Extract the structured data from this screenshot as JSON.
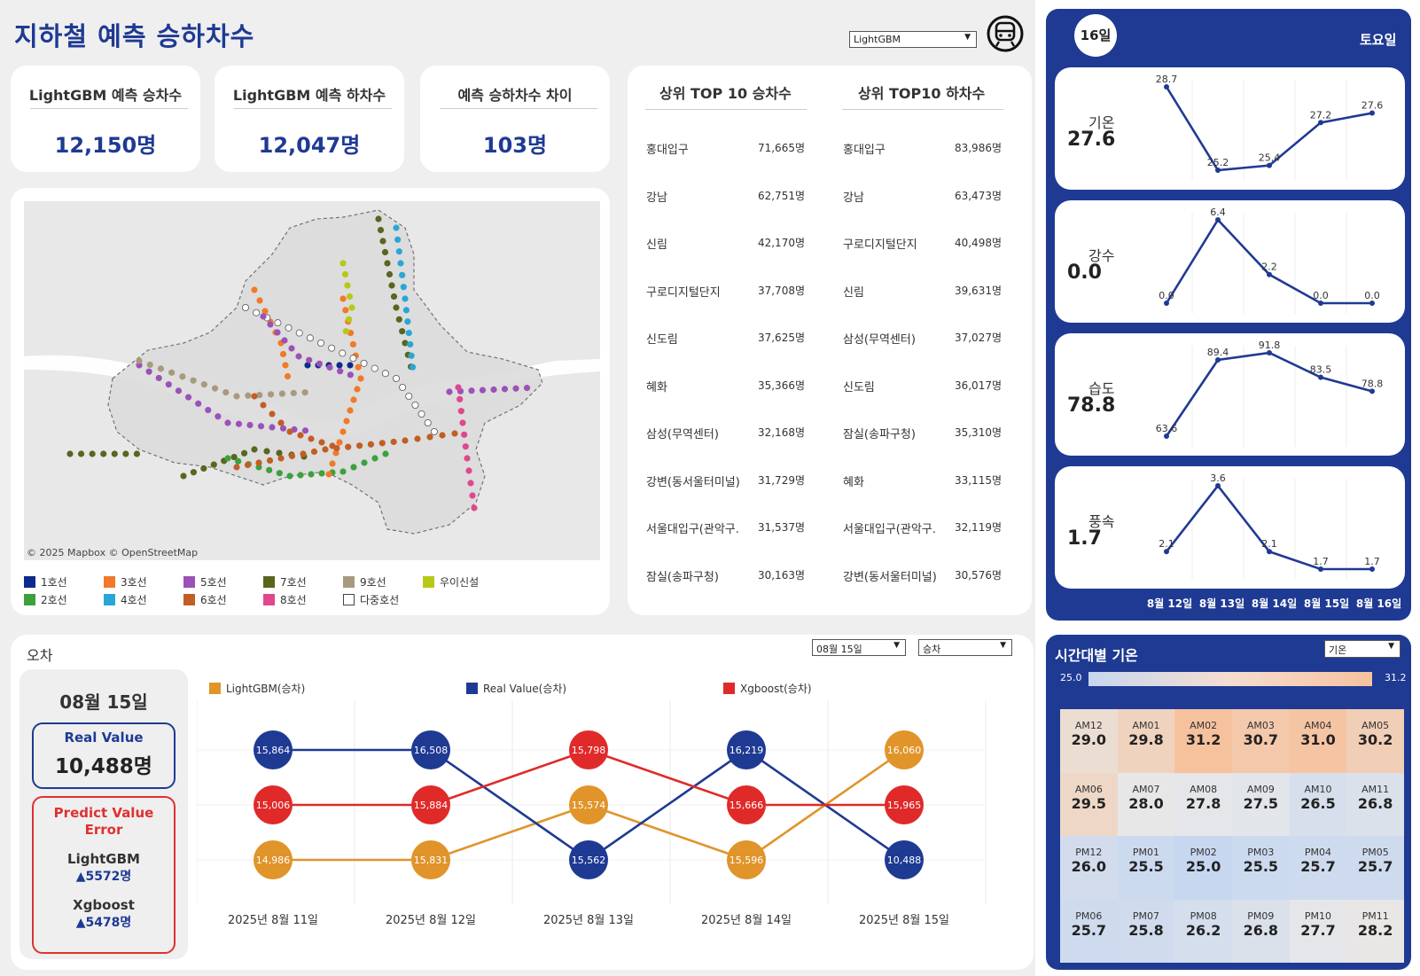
{
  "header": {
    "title": "지하철 예측 승하차수",
    "model_select": "LightGBM"
  },
  "kpis": [
    {
      "label": "LightGBM 예측 승차수",
      "value": "12,150명"
    },
    {
      "label": "LightGBM 예측 하차수",
      "value": "12,047명"
    },
    {
      "label": "예측 승하차수 차이",
      "value": "103명"
    }
  ],
  "map": {
    "credit": "© 2025 Mapbox  © OpenStreetMap",
    "legend": [
      {
        "label": "1호선",
        "color": "#0d2b8a"
      },
      {
        "label": "3호선",
        "color": "#f07a28"
      },
      {
        "label": "5호선",
        "color": "#9b52b8"
      },
      {
        "label": "7호선",
        "color": "#58661e"
      },
      {
        "label": "9호선",
        "color": "#a89a7e"
      },
      {
        "label": "우이신설",
        "color": "#b7c817"
      },
      {
        "label": "2호선",
        "color": "#3ca13c"
      },
      {
        "label": "4호선",
        "color": "#2aa6d6"
      },
      {
        "label": "6호선",
        "color": "#c25e24"
      },
      {
        "label": "8호선",
        "color": "#e0478e"
      },
      {
        "label": "다중호선",
        "color": "#ffffff"
      }
    ]
  },
  "top10": {
    "boarding_title": "상위 TOP 10 승차수",
    "alighting_title": "상위 TOP10 하차수",
    "boarding": [
      {
        "name": "홍대입구",
        "value": "71,665명"
      },
      {
        "name": "강남",
        "value": "62,751명"
      },
      {
        "name": "신림",
        "value": "42,170명"
      },
      {
        "name": "구로디지털단지",
        "value": "37,708명"
      },
      {
        "name": "신도림",
        "value": "37,625명"
      },
      {
        "name": "혜화",
        "value": "35,366명"
      },
      {
        "name": "삼성(무역센터)",
        "value": "32,168명"
      },
      {
        "name": "강변(동서울터미널)",
        "value": "31,729명"
      },
      {
        "name": "서울대입구(관악구.",
        "value": "31,537명"
      },
      {
        "name": "잠실(송파구청)",
        "value": "30,163명"
      }
    ],
    "alighting": [
      {
        "name": "홍대입구",
        "value": "83,986명"
      },
      {
        "name": "강남",
        "value": "63,473명"
      },
      {
        "name": "구로디지털단지",
        "value": "40,498명"
      },
      {
        "name": "신림",
        "value": "39,631명"
      },
      {
        "name": "삼성(무역센터)",
        "value": "37,027명"
      },
      {
        "name": "신도림",
        "value": "36,017명"
      },
      {
        "name": "잠실(송파구청)",
        "value": "35,310명"
      },
      {
        "name": "혜화",
        "value": "33,115명"
      },
      {
        "name": "서울대입구(관악구.",
        "value": "32,119명"
      },
      {
        "name": "강변(동서울터미널)",
        "value": "30,576명"
      }
    ]
  },
  "weather": {
    "day_badge": "16일",
    "weekday": "토요일",
    "dates": [
      "8월 12일",
      "8월 13일",
      "8월 14일",
      "8월 15일",
      "8월 16일"
    ],
    "metrics": [
      {
        "label": "기온",
        "value": "27.6",
        "series": [
          28.7,
          25.2,
          25.4,
          27.2,
          27.6
        ],
        "labels": [
          "28.7",
          "25.2",
          "25.4",
          "27.2",
          "27.6"
        ]
      },
      {
        "label": "강수",
        "value": "0.0",
        "series": [
          0.0,
          6.4,
          2.2,
          0.0,
          0.0
        ],
        "labels": [
          "0.0",
          "6.4",
          "2.2",
          "0.0",
          "0.0"
        ]
      },
      {
        "label": "습도",
        "value": "78.8",
        "series": [
          63.6,
          89.4,
          91.8,
          83.5,
          78.8
        ],
        "labels": [
          "63.6",
          "89.4",
          "91.8",
          "83.5",
          "78.8"
        ]
      },
      {
        "label": "풍속",
        "value": "1.7",
        "series": [
          2.1,
          3.6,
          2.1,
          1.7,
          1.7
        ],
        "labels": [
          "2.1",
          "3.6",
          "2.1",
          "1.7",
          "1.7"
        ]
      }
    ]
  },
  "hourly": {
    "title": "시간대별 기온",
    "select": "기온",
    "min_label": "25.0",
    "max_label": "31.2",
    "cells": [
      {
        "t": "AM12",
        "v": "29.0"
      },
      {
        "t": "AM01",
        "v": "29.8"
      },
      {
        "t": "AM02",
        "v": "31.2"
      },
      {
        "t": "AM03",
        "v": "30.7"
      },
      {
        "t": "AM04",
        "v": "31.0"
      },
      {
        "t": "AM05",
        "v": "30.2"
      },
      {
        "t": "AM06",
        "v": "29.5"
      },
      {
        "t": "AM07",
        "v": "28.0"
      },
      {
        "t": "AM08",
        "v": "27.8"
      },
      {
        "t": "AM09",
        "v": "27.5"
      },
      {
        "t": "AM10",
        "v": "26.5"
      },
      {
        "t": "AM11",
        "v": "26.8"
      },
      {
        "t": "PM12",
        "v": "26.0"
      },
      {
        "t": "PM01",
        "v": "25.5"
      },
      {
        "t": "PM02",
        "v": "25.0"
      },
      {
        "t": "PM03",
        "v": "25.5"
      },
      {
        "t": "PM04",
        "v": "25.7"
      },
      {
        "t": "PM05",
        "v": "25.7"
      },
      {
        "t": "PM06",
        "v": "25.7"
      },
      {
        "t": "PM07",
        "v": "25.8"
      },
      {
        "t": "PM08",
        "v": "26.2"
      },
      {
        "t": "PM09",
        "v": "26.8"
      },
      {
        "t": "PM10",
        "v": "27.7"
      },
      {
        "t": "PM11",
        "v": "28.2"
      }
    ]
  },
  "error": {
    "title": "오차",
    "date_select": "08월 15일",
    "type_select": "승차",
    "date_label": "08월 15일",
    "real_label": "Real Value",
    "real_value": "10,488명",
    "pred_label": "Predict Value Error",
    "lgbm_label": "LightGBM",
    "lgbm_error": "▲5572명",
    "xgb_label": "Xgboost",
    "xgb_error": "▲5478명"
  },
  "chart_data": {
    "type": "line",
    "categories": [
      "2025년 8월 11일",
      "2025년 8월 12일",
      "2025년 8월 13일",
      "2025년 8월 14일",
      "2025년 8월 15일"
    ],
    "series": [
      {
        "name": "LightGBM(승차)",
        "color": "#e0942a",
        "values": [
          14986,
          15831,
          15574,
          15596,
          16060
        ]
      },
      {
        "name": "Real Value(승차)",
        "color": "#1f3a93",
        "values": [
          15864,
          16508,
          15562,
          16219,
          10488
        ]
      },
      {
        "name": "Xgboost(승차)",
        "color": "#e02a2a",
        "values": [
          15006,
          15884,
          15798,
          15666,
          15965
        ]
      }
    ]
  }
}
